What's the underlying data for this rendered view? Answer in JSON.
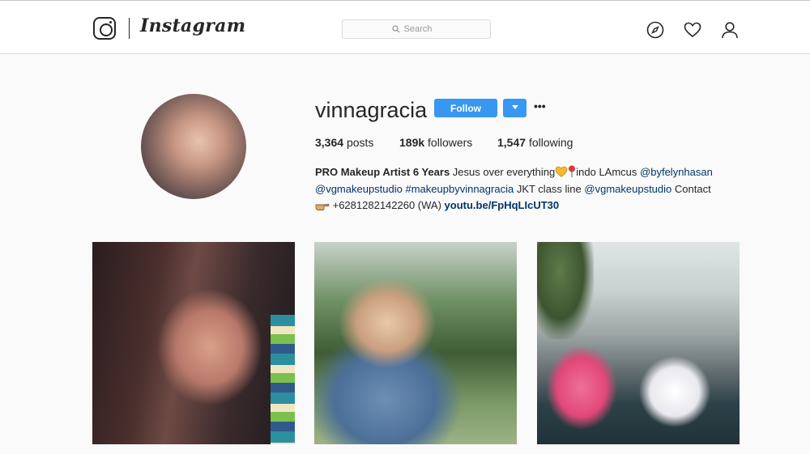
{
  "app": {
    "wordmark": "Instagram"
  },
  "search": {
    "placeholder": "Search"
  },
  "nav": {
    "icons": [
      "compass-icon",
      "heart-icon",
      "user-icon"
    ]
  },
  "profile": {
    "username": "vinnagracia",
    "follow_label": "Follow",
    "more_label": "•••",
    "stats": {
      "posts_count": "3,364",
      "posts_label": "posts",
      "followers_count": "189k",
      "followers_label": "followers",
      "following_count": "1,547",
      "following_label": "following"
    },
    "bio": {
      "title": "PRO Makeup Artist 6 Years",
      "text1": " Jesus over everything",
      "text2": "indo LAmcus ",
      "mention1": "@byfelynhasan",
      "mention2": "@vgmakeupstudio",
      "hashtag": "#makeupbyvinnagracia",
      "text3": " JKT class line ",
      "mention3": "@vgmakeupstudio",
      "text4": " Contact",
      "phone": " +6281282142260 (WA) ",
      "url": "youtu.be/FpHqLIcUT30"
    }
  },
  "colors": {
    "follow_blue": "#3897f0",
    "link_blue": "#003569",
    "text": "#262626"
  }
}
